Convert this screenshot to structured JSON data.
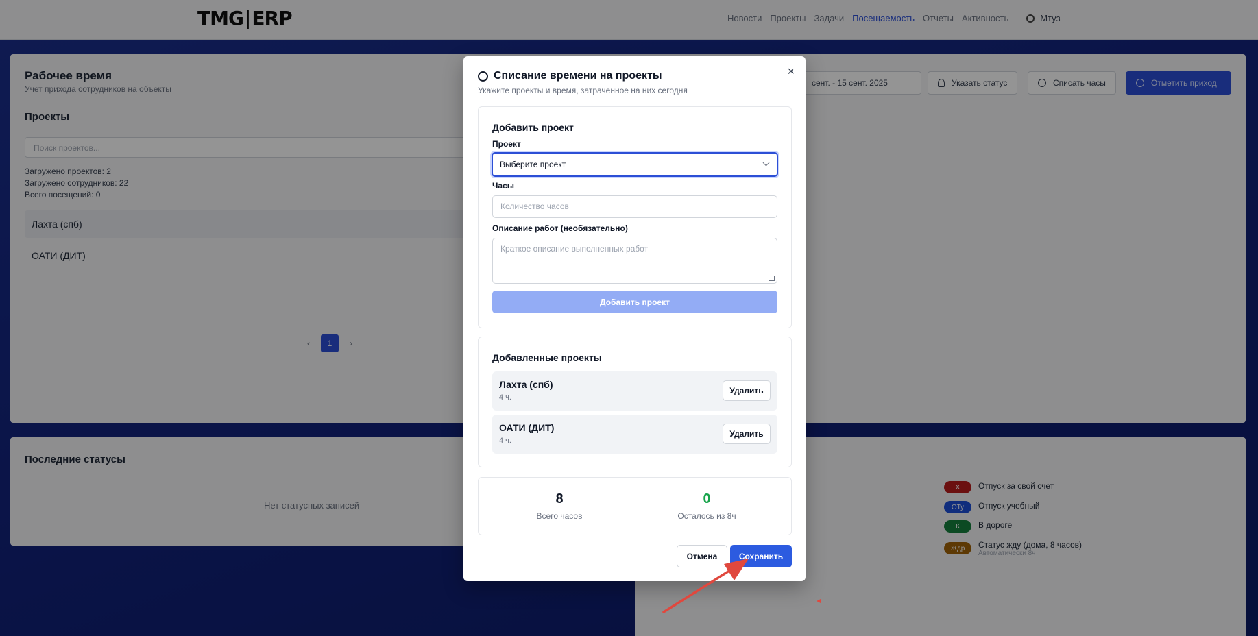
{
  "app": {
    "logo_left": "TMG",
    "logo_sep": "|",
    "logo_right": "ERP",
    "nav": [
      "Новости",
      "Проекты",
      "Задачи",
      "Посещаемость",
      "Отчеты",
      "Активность"
    ],
    "nav_active": "Посещаемость",
    "user": "Мтуз"
  },
  "worktime": {
    "title": "Рабочее время",
    "subtitle": "Учет прихода сотрудников на объекты",
    "projects_heading": "Проекты",
    "search_placeholder": "Поиск проектов...",
    "stats": [
      "Загружено проектов: 2",
      "Загружено сотрудников: 22",
      "Всего посещений: 0"
    ],
    "projects": [
      "Лахта (спб)",
      "ОАТИ (ДИТ)"
    ],
    "page": "1",
    "date_range": "сент. - 15 сент. 2025",
    "btn_status": "Указать статус",
    "btn_hours": "Списать часы",
    "btn_checkin": "Отметить приход"
  },
  "statuses": {
    "title": "Последние статусы",
    "empty": "Нет статусных записей"
  },
  "legend": [
    {
      "code": "Х",
      "label": "Отпуск за свой счет",
      "color": "#b91c1c",
      "sub": ""
    },
    {
      "code": "ОТу",
      "label": "Отпуск учебный",
      "color": "#1d4ed8",
      "sub": ""
    },
    {
      "code": "К",
      "label": "В дороге",
      "color": "#15803d",
      "sub": ""
    },
    {
      "code": "Ждр",
      "label": "Статус жду (дома, 8 часов)",
      "color": "#a16207",
      "sub": "Автоматически 8ч"
    }
  ],
  "modal": {
    "title": "Списание времени на проекты",
    "subtitle": "Укажите проекты и время, затраченное на них сегодня",
    "close": "×",
    "add_section": {
      "heading": "Добавить проект",
      "project_label": "Проект",
      "project_value": "Выберите проект",
      "hours_label": "Часы",
      "hours_placeholder": "Количество часов",
      "desc_label": "Описание работ (необязательно)",
      "desc_placeholder": "Краткое описание выполненных работ",
      "add_button": "Добавить проект"
    },
    "added_section": {
      "heading": "Добавленные проекты",
      "items": [
        {
          "name": "Лахта (спб)",
          "hours": "4 ч.",
          "delete": "Удалить"
        },
        {
          "name": "ОАТИ (ДИТ)",
          "hours": "4 ч.",
          "delete": "Удалить"
        }
      ]
    },
    "summary": {
      "total_value": "8",
      "total_label": "Всего часов",
      "left_value": "0",
      "left_label": "Осталось из 8ч",
      "left_color": "#16a34a"
    },
    "cancel": "Отмена",
    "save": "Сохранить"
  },
  "colors": {
    "accent": "#2c5be0",
    "arrow": "#e0483e"
  }
}
